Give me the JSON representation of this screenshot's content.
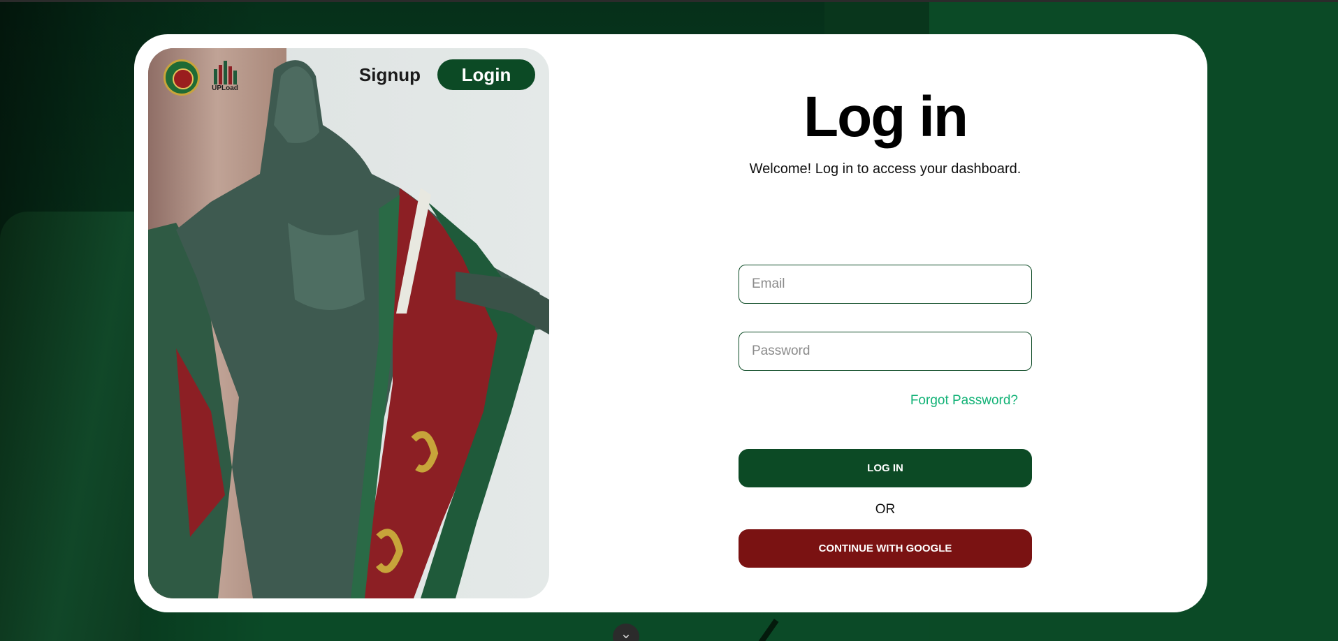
{
  "colors": {
    "brand_green": "#0c4a25",
    "brand_maroon": "#7a1212",
    "link_green": "#12b276",
    "card_bg": "#ffffff"
  },
  "header": {
    "logos": [
      "up-seal-icon",
      "upload-logo-icon"
    ],
    "upload_logo_text": "UPLoad",
    "signup_label": "Signup",
    "login_label": "Login"
  },
  "form": {
    "title": "Log in",
    "subtitle": "Welcome! Log in to access your dashboard.",
    "email_placeholder": "Email",
    "password_placeholder": "Password",
    "forgot_label": "Forgot Password?",
    "login_button": "LOG IN",
    "or_label": "OR",
    "google_button": "CONTINUE WITH GOOGLE"
  },
  "scroll": {
    "icon": "chevron-down-icon",
    "glyph": "⌄"
  }
}
